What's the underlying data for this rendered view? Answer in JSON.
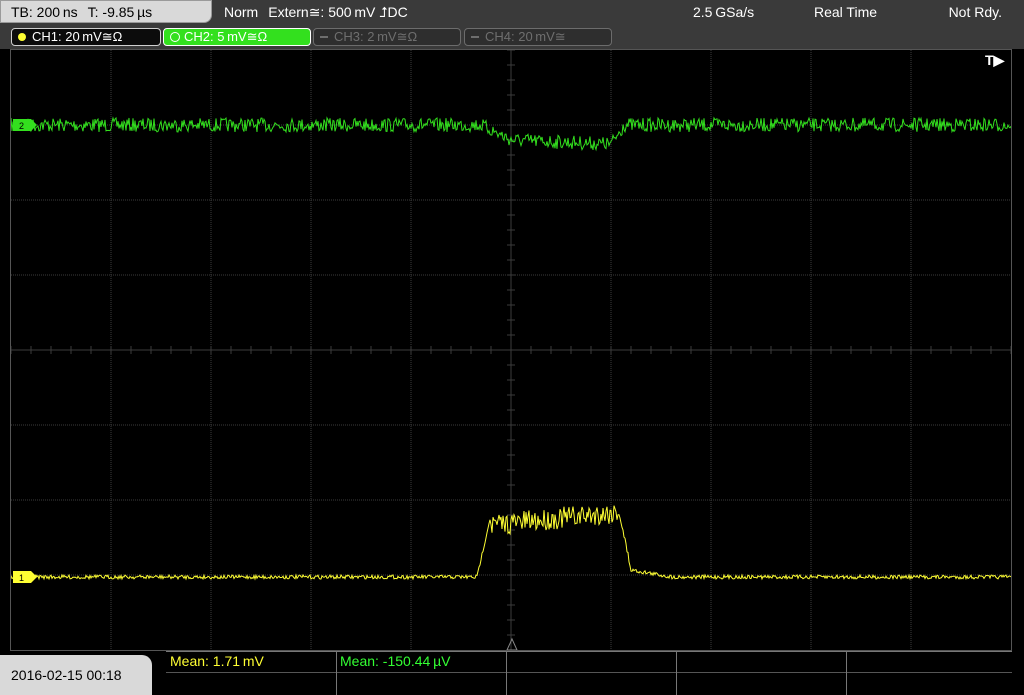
{
  "top": {
    "timebase": "TB: 200 ns",
    "trigger_time": "T: -9.85 µs",
    "trigger_mode": "Norm",
    "trigger_source": "Extern≅: 500 mV ⮥DC",
    "sample_rate": "2.5 GSa/s",
    "acq_mode": "Real Time",
    "status": "Not Rdy."
  },
  "channels": [
    {
      "label": "CH1: 20 mV≅Ω",
      "state": "on",
      "color": "#ffff33"
    },
    {
      "label": "CH2: 5 mV≅Ω",
      "state": "active",
      "color": "#33e01e"
    },
    {
      "label": "CH3: 2 mV≅Ω",
      "state": "off",
      "color": "#6e6e6e"
    },
    {
      "label": "CH4: 20 mV≅",
      "state": "off",
      "color": "#6e6e6e"
    }
  ],
  "screen": {
    "trigger_marker": "T▶",
    "ch2_marker_label": "2",
    "ch1_marker_label": "1",
    "ch2_color": "#33e01e",
    "ch1_color": "#ffff33"
  },
  "measurements": {
    "ch1_mean": "Mean: 1.71 mV",
    "ch2_mean": "Mean: -150.44 µV"
  },
  "datetime": "2016-02-15 00:18"
}
